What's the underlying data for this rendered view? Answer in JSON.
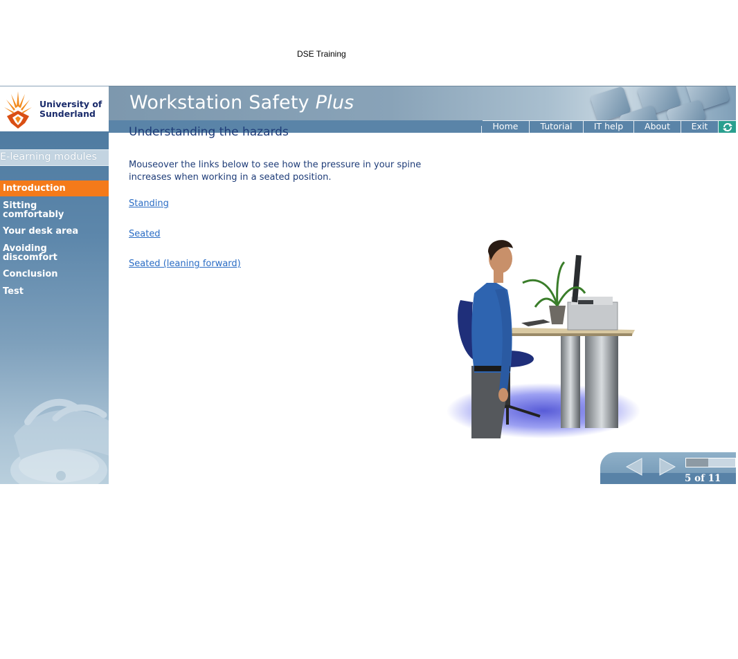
{
  "document_title": "DSE Training",
  "logo": {
    "line1": "University of",
    "line2": "Sunderland"
  },
  "banner": {
    "title": "Workstation Safety",
    "title_emph": "Plus"
  },
  "nav": [
    "Home",
    "Tutorial",
    "IT help",
    "About",
    "Exit"
  ],
  "sidebar": {
    "header": "E-learning modules",
    "items": [
      {
        "label": "Introduction",
        "active": true
      },
      {
        "label": "Sitting comfortably"
      },
      {
        "label": "Your desk area"
      },
      {
        "label": "Avoiding discomfort"
      },
      {
        "label": "Conclusion"
      },
      {
        "label": "Test"
      }
    ]
  },
  "content": {
    "heading": "Understanding the hazards",
    "intro": "Mouseover the links below to see how the pressure in your spine increases when working in a seated position.",
    "links": [
      "Standing",
      "Seated",
      "Seated (leaning forward)"
    ]
  },
  "pager": {
    "label": "5 of 11",
    "progress": 0.45
  },
  "colors": {
    "accent": "#f47a1a",
    "nav": "#5a84a8",
    "text": "#1e3c78",
    "link": "#2a6cc4"
  }
}
